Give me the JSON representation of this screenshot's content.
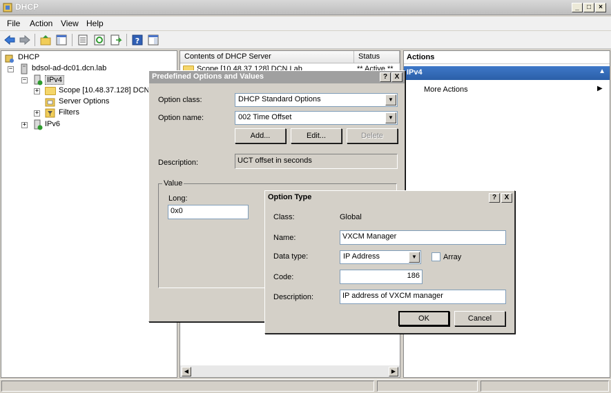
{
  "window": {
    "title": "DHCP"
  },
  "menu": [
    "File",
    "Action",
    "View",
    "Help"
  ],
  "tree": {
    "root": "DHCP",
    "server": "bdsol-ad-dc01.dcn.lab",
    "ipv4": "IPv4",
    "scope": "Scope [10.48.37.128] DCN",
    "server_options": "Server Options",
    "filters": "Filters",
    "ipv6": "IPv6"
  },
  "content": {
    "col_name": "Contents of DHCP Server",
    "col_status": "Status",
    "row_name": "Scope [10.48.37.128] DCN Lab",
    "row_status": "** Active **"
  },
  "actions": {
    "header": "Actions",
    "selected": "IPv4",
    "more": "More Actions"
  },
  "predefined": {
    "title": "Predefined Options and Values",
    "help_btn": "?",
    "close_btn": "X",
    "option_class_label": "Option class:",
    "option_class_value": "DHCP Standard Options",
    "option_name_label": "Option name:",
    "option_name_value": "002 Time Offset",
    "add": "Add...",
    "edit": "Edit...",
    "delete": "Delete",
    "description_label": "Description:",
    "description_value": "UCT offset in seconds",
    "value_group": "Value",
    "long_label": "Long:",
    "long_value": "0x0"
  },
  "option_type": {
    "title": "Option Type",
    "help_btn": "?",
    "close_btn": "X",
    "class_label": "Class:",
    "class_value": "Global",
    "name_label": "Name:",
    "name_value": "VXCM Manager",
    "datatype_label": "Data type:",
    "datatype_value": "IP Address",
    "array_label": "Array",
    "code_label": "Code:",
    "code_value": "186",
    "description_label": "Description:",
    "description_value": "IP address of VXCM manager",
    "ok": "OK",
    "cancel": "Cancel"
  }
}
